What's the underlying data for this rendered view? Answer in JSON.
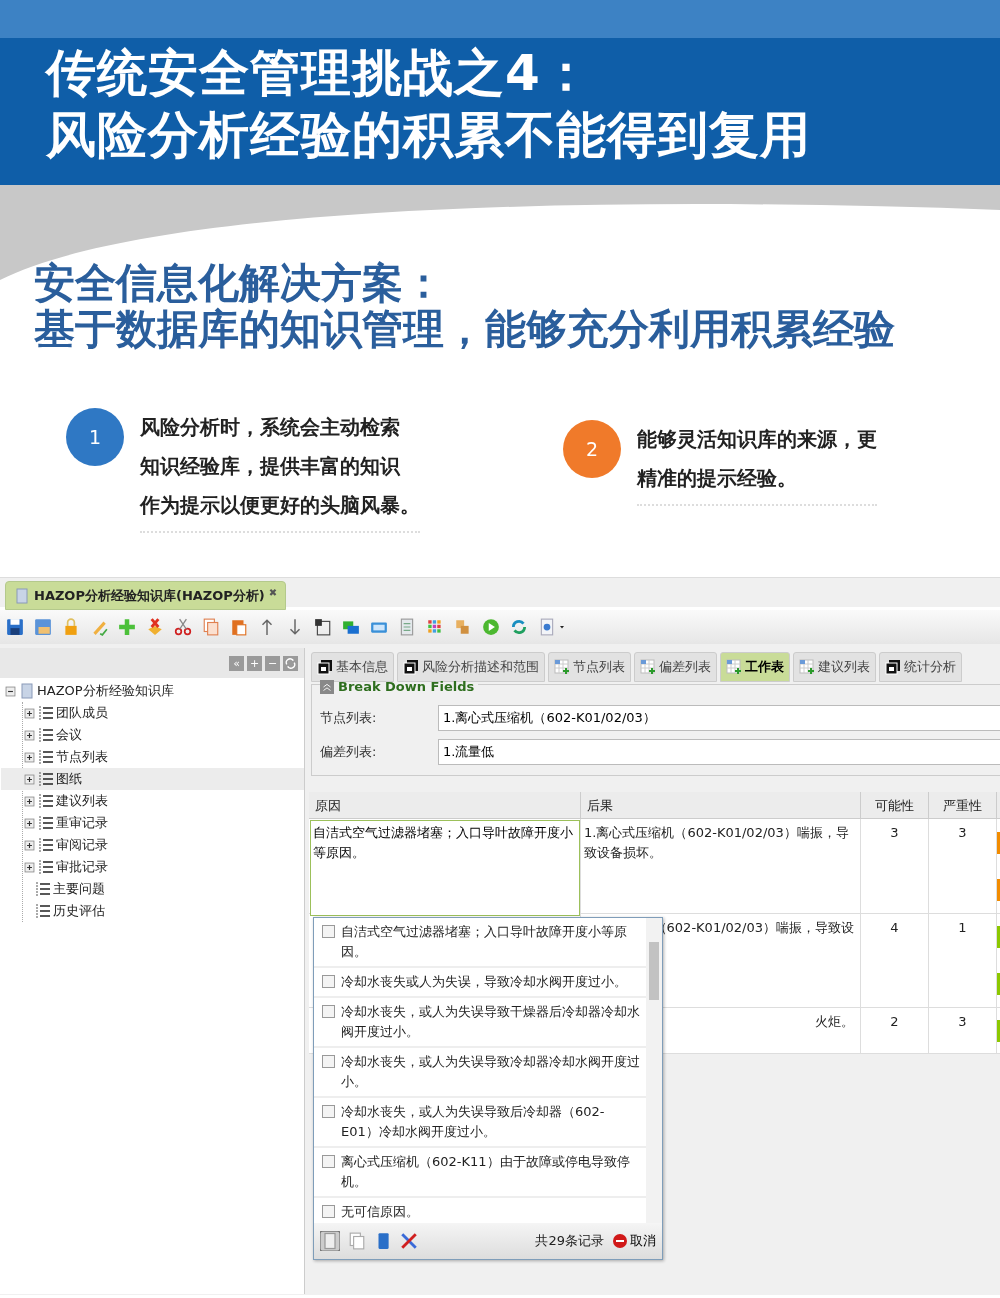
{
  "header": {
    "title_lines": [
      "传统安全管理挑战之4：",
      "风险分析经验的积累不能得到复用"
    ]
  },
  "solution": {
    "title_lines": [
      "安全信息化解决方案：",
      "基于数据库的知识管理，能够充分利用积累经验"
    ]
  },
  "points": [
    {
      "number": "1",
      "color": "#2f78c4",
      "lines": [
        "风险分析时，系统会主动检索",
        "知识经验库，提供丰富的知识",
        "作为提示以便更好的头脑风暴。"
      ]
    },
    {
      "number": "2",
      "color": "#f07a2a",
      "lines": [
        "能够灵活知识库的来源，更",
        "精准的提示经验。"
      ]
    }
  ],
  "app": {
    "doc_tab": {
      "label": "HAZOP分析经验知识库(HAZOP分析)",
      "close": "✖"
    },
    "tree_tools": [
      "«",
      "+",
      "−"
    ],
    "tree": {
      "label": "HAZOP分析经验知识库",
      "expanded": true,
      "children": [
        {
          "label": "团队成员",
          "expandable": true,
          "selected": false
        },
        {
          "label": "会议",
          "expandable": true,
          "selected": false
        },
        {
          "label": "节点列表",
          "expandable": true,
          "selected": false
        },
        {
          "label": "图纸",
          "expandable": true,
          "selected": true
        },
        {
          "label": "建议列表",
          "expandable": true,
          "selected": false
        },
        {
          "label": "重审记录",
          "expandable": true,
          "selected": false
        },
        {
          "label": "审阅记录",
          "expandable": true,
          "selected": false
        },
        {
          "label": "审批记录",
          "expandable": true,
          "selected": false
        },
        {
          "label": "主要问题",
          "expandable": false,
          "selected": false
        },
        {
          "label": "历史评估",
          "expandable": false,
          "selected": false
        }
      ]
    },
    "tabs": [
      {
        "label": "基本信息",
        "kind": "window",
        "selected": false
      },
      {
        "label": "风险分析描述和范围",
        "kind": "window",
        "selected": false
      },
      {
        "label": "节点列表",
        "kind": "grid",
        "selected": false
      },
      {
        "label": "偏差列表",
        "kind": "grid",
        "selected": false
      },
      {
        "label": "工作表",
        "kind": "grid",
        "selected": true
      },
      {
        "label": "建议列表",
        "kind": "grid",
        "selected": false
      },
      {
        "label": "统计分析",
        "kind": "window",
        "selected": false
      }
    ],
    "fieldset": {
      "legend": "Break Down Fields",
      "fields": [
        {
          "label": "节点列表:",
          "value": "1.离心式压缩机（602-K01/02/03）"
        },
        {
          "label": "偏差列表:",
          "value": "1.流量低"
        }
      ]
    },
    "table": {
      "columns": [
        "原因",
        "后果",
        "可能性",
        "严重性"
      ],
      "rows": [
        {
          "cause": "自洁式空气过滤器堵塞；入口导叶故障开度小等原因。",
          "consequence": "1.离心式压缩机（602-K01/02/03）喘振，导致设备损坏。",
          "likelihood": "3",
          "severity": "3",
          "color": "#f28c00"
        },
        {
          "consequence": "（602-K01/02/03）喘振，导致设",
          "likelihood": "4",
          "severity": "1",
          "color": "#8cc800"
        },
        {
          "consequence": "火炬。",
          "likelihood": "2",
          "severity": "3",
          "color": "#8cc800"
        }
      ]
    },
    "dropdown": {
      "items": [
        {
          "text": "自洁式空气过滤器堵塞；入口导叶故障开度小等原因。",
          "checked": false
        },
        {
          "text": "冷却水丧失或人为失误，导致冷却水阀开度过小。",
          "checked": false
        },
        {
          "text": "冷却水丧失，或人为失误导致干燥器后冷却器冷却水阀开度过小。",
          "checked": false
        },
        {
          "text": "冷却水丧失，或人为失误导致冷却器冷却水阀开度过小。",
          "checked": false
        },
        {
          "text": "冷却水丧失，或人为失误导致后冷却器（602-E01）冷却水阀开度过小。",
          "checked": false
        },
        {
          "text": "离心式压缩机（602-K11）由于故障或停电导致停机。",
          "checked": false
        },
        {
          "text": "无可信原因。",
          "checked": false
        }
      ],
      "count": "共29条记录",
      "cancel": "取消"
    }
  }
}
